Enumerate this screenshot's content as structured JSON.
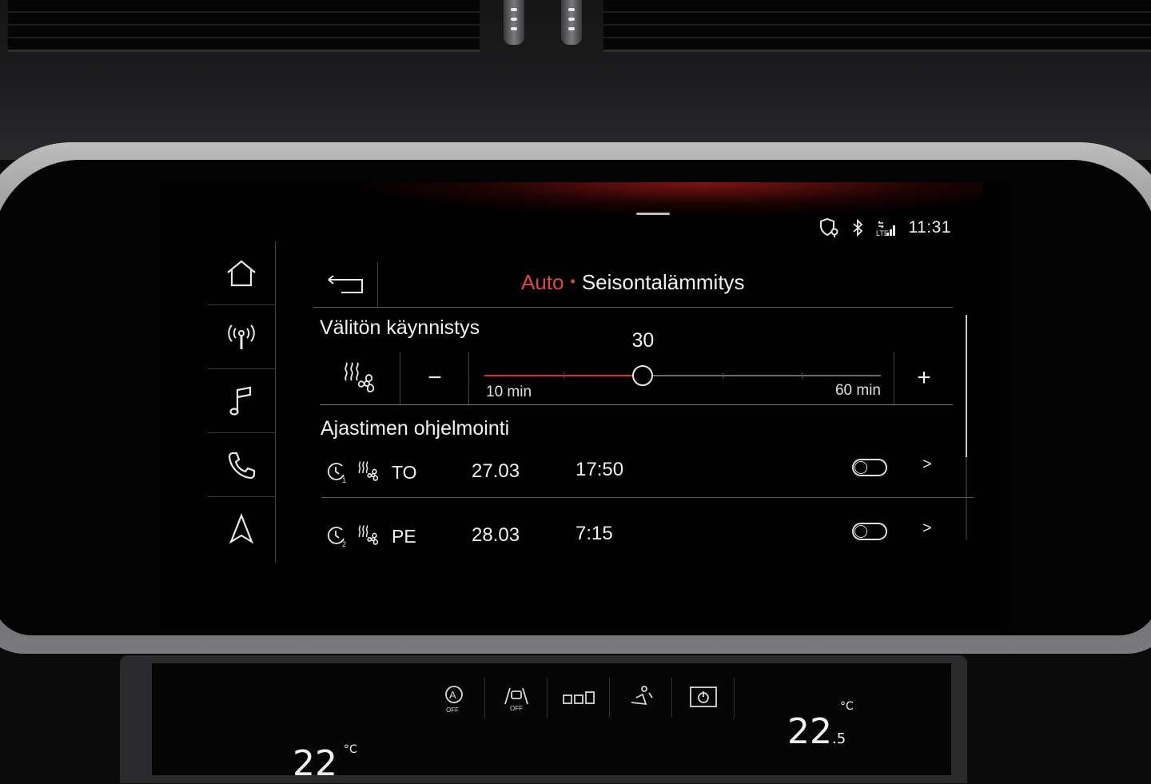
{
  "status": {
    "time": "11:31",
    "network": "LTE"
  },
  "header": {
    "crumb_parent": "Auto",
    "separator": "•",
    "title": "Seisontalämmitys"
  },
  "immediate_start": {
    "title": "Välitön käynnistys",
    "value": "30",
    "value_minutes": 30,
    "min_label": "10 min",
    "max_label": "60 min",
    "min": 10,
    "max": 60,
    "minus_label": "−",
    "plus_label": "+"
  },
  "timers": {
    "title": "Ajastimen ohjelmointi",
    "items": [
      {
        "index": "1",
        "day": "TO",
        "date": "27.03",
        "time": "17:50",
        "enabled": false,
        "chevron": ">"
      },
      {
        "index": "2",
        "day": "PE",
        "date": "28.03",
        "time": "7:15",
        "enabled": false,
        "chevron": ">"
      }
    ]
  },
  "sidebar": {
    "items": [
      {
        "icon": "home-icon"
      },
      {
        "icon": "radio-icon"
      },
      {
        "icon": "music-icon"
      },
      {
        "icon": "phone-icon"
      },
      {
        "icon": "navigation-icon"
      }
    ]
  },
  "climate": {
    "buttons": [
      {
        "icon": "auto-recirculation-off-icon",
        "label": "OFF"
      },
      {
        "icon": "lane-assist-off-icon",
        "label": "OFF"
      },
      {
        "icon": "parking-sensor-icon"
      },
      {
        "icon": "seat-icon"
      },
      {
        "icon": "climate-power-icon"
      }
    ],
    "temp_right": "22",
    "temp_right_decimal": ".5",
    "temp_left": "22",
    "unit": "°C"
  },
  "colors": {
    "accent": "#e2473e",
    "slider_fill": "#d93030"
  }
}
